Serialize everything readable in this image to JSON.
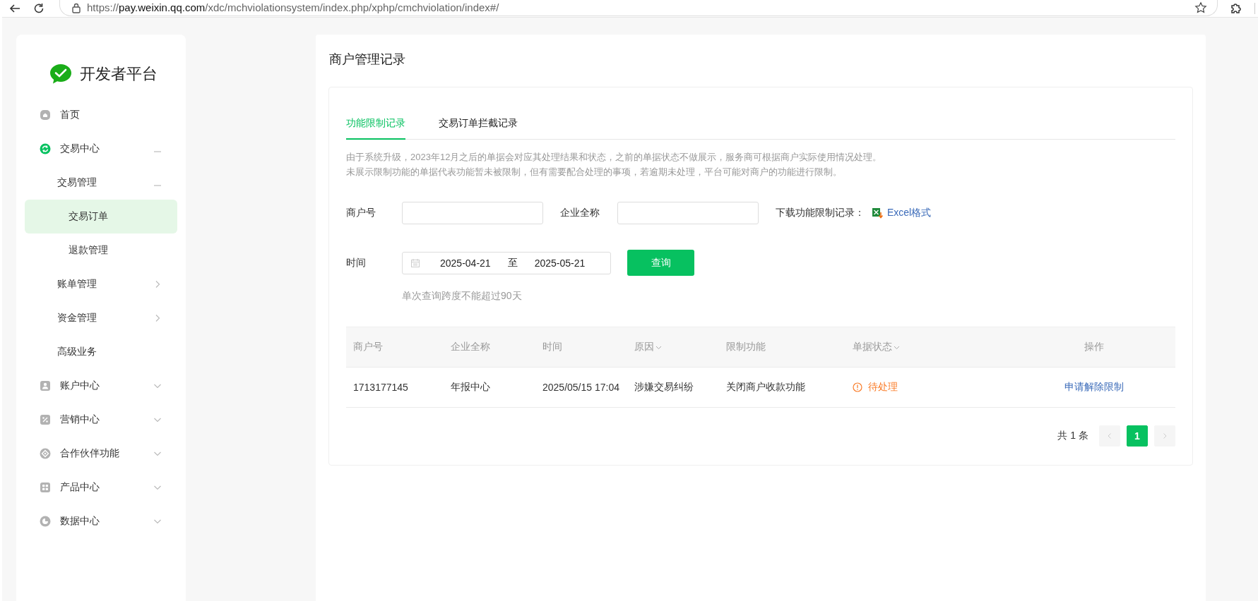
{
  "browser": {
    "url_scheme": "https://",
    "url_host": "pay.weixin.qq.com",
    "url_path": "/xdc/mchviolationsystem/index.php/xphp/cmchviolation/index#/"
  },
  "sidebar": {
    "logo_text": "开发者平台",
    "items": [
      {
        "label": "首页",
        "selected": false
      },
      {
        "label": "交易中心",
        "selected": false,
        "expanded": true,
        "children": [
          {
            "label": "交易管理",
            "selected": false,
            "expanded": true,
            "children": [
              {
                "label": "交易订单",
                "selected": true
              },
              {
                "label": "退款管理",
                "selected": false
              }
            ]
          },
          {
            "label": "账单管理",
            "selected": false,
            "expanded": false
          },
          {
            "label": "资金管理",
            "selected": false,
            "expanded": false
          },
          {
            "label": "高级业务",
            "selected": false
          }
        ]
      },
      {
        "label": "账户中心",
        "selected": false,
        "expanded": false
      },
      {
        "label": "营销中心",
        "selected": false,
        "expanded": false
      },
      {
        "label": "合作伙伴功能",
        "selected": false,
        "expanded": false
      },
      {
        "label": "产品中心",
        "selected": false,
        "expanded": false
      },
      {
        "label": "数据中心",
        "selected": false,
        "expanded": false
      }
    ]
  },
  "main": {
    "title": "商户管理记录",
    "tabs": [
      {
        "label": "功能限制记录",
        "selected": true
      },
      {
        "label": "交易订单拦截记录",
        "selected": false
      }
    ],
    "notice": [
      "由于系统升级，2023年12月之后的单据会对应其处理结果和状态，之前的单据状态不做展示，服务商可根据商户实际使用情况处理。",
      "未展示限制功能的单据代表功能暂未被限制，但有需要配合处理的事项，若逾期未处理，平台可能对商户的功能进行限制。"
    ],
    "filters": [
      {
        "label": "商户号"
      },
      {
        "label": "企业全称"
      }
    ],
    "download": {
      "label": "下载功能限制记录：",
      "link": "Excel格式"
    },
    "date": {
      "label": "时间",
      "start": "2025-04-21",
      "separator": "至",
      "end": "2025-05-21"
    },
    "query_button": "查询",
    "hint": "单次查询跨度不能超过90天",
    "table": {
      "columns": [
        {
          "label": "商户号",
          "sortable": false
        },
        {
          "label": "企业全称",
          "sortable": false
        },
        {
          "label": "时间",
          "sortable": false
        },
        {
          "label": "原因",
          "sortable": true
        },
        {
          "label": "限制功能",
          "sortable": false
        },
        {
          "label": "单据状态",
          "sortable": true
        },
        {
          "label": "操作",
          "sortable": false
        }
      ],
      "rows": [
        {
          "cells": [
            "1713177145",
            "年报中心",
            "2025/05/15 17:04",
            "涉嫌交易纠纷",
            "关闭商户收款功能"
          ],
          "status": {
            "text": "待处理",
            "kind": "pending"
          },
          "action": "申请解除限制"
        }
      ]
    },
    "pagination": {
      "total": "共 1 条",
      "prev_disabled": true,
      "next_disabled": true,
      "pages": [
        {
          "label": "1",
          "selected": true
        }
      ]
    }
  }
}
